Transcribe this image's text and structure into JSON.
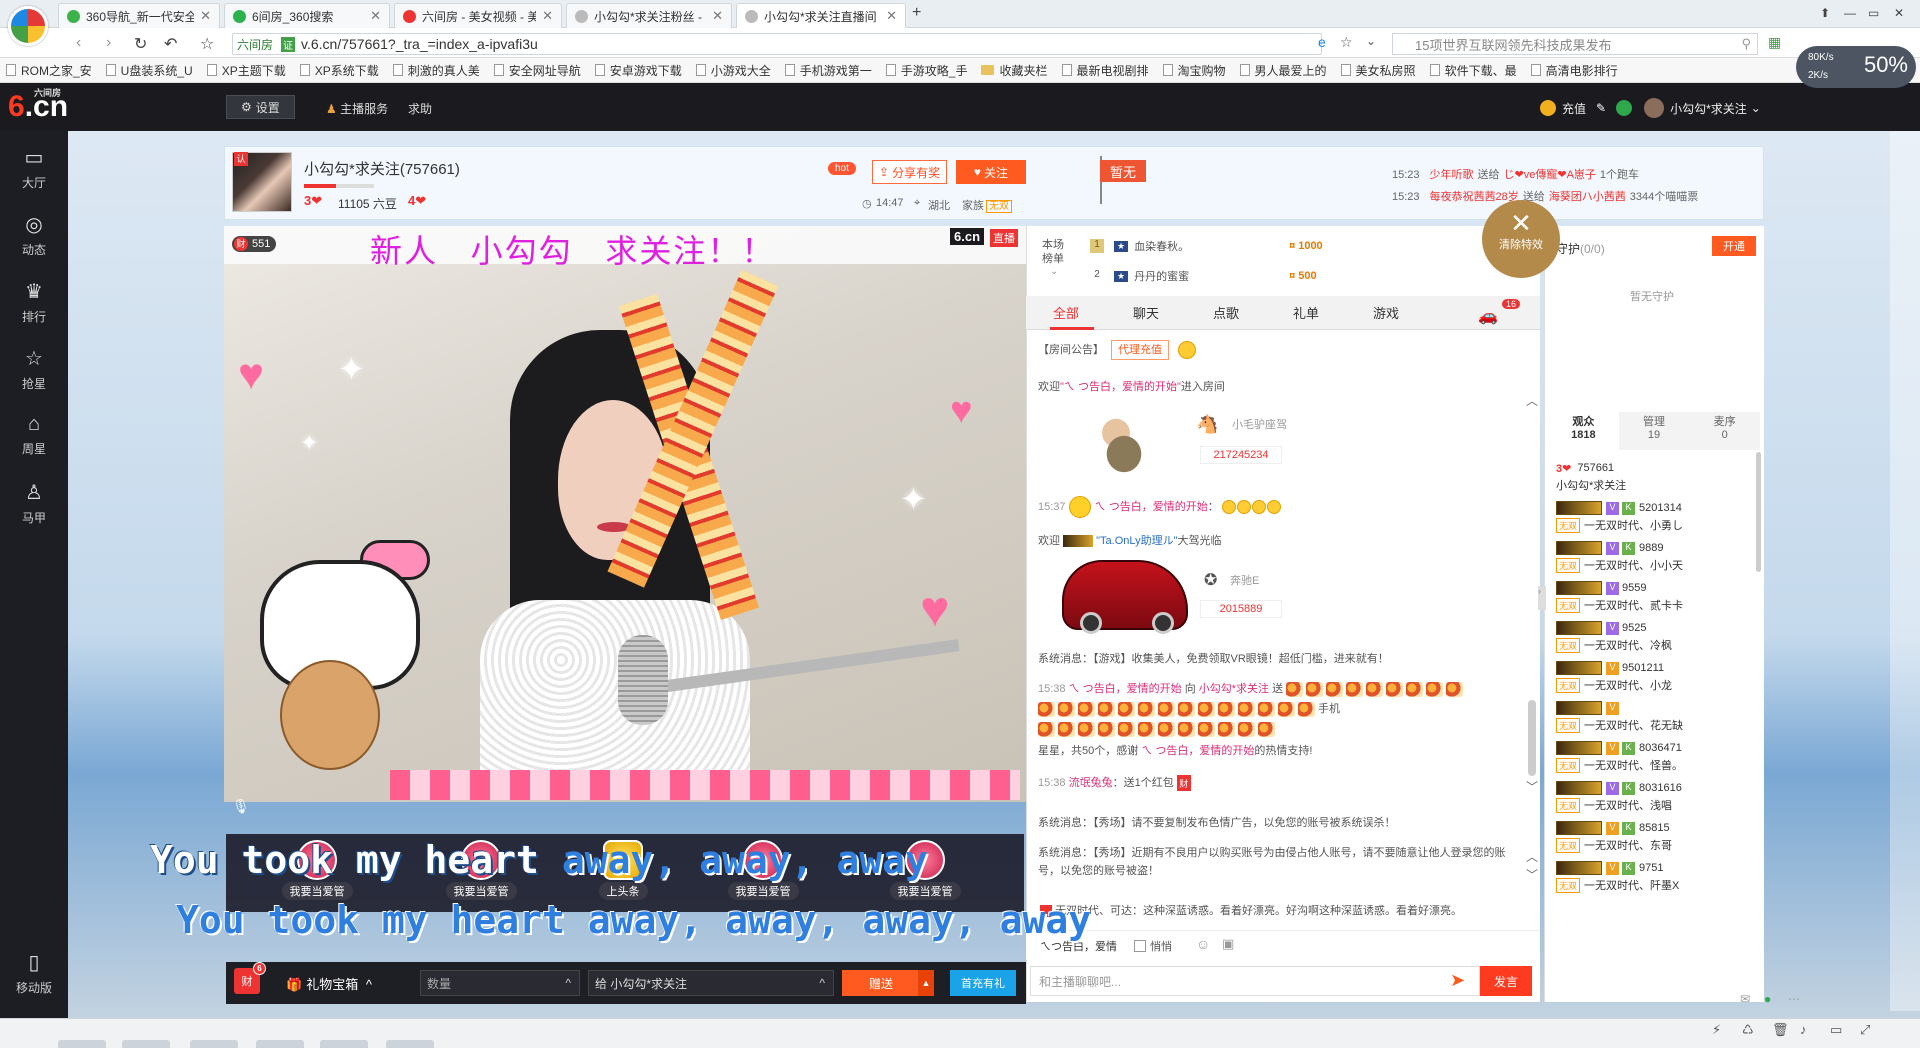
{
  "browser": {
    "tabs": [
      {
        "label": "360导航_新一代安全上网导航",
        "color": "#3cb34a"
      },
      {
        "label": "6间房_360搜索",
        "color": "#2bb24c"
      },
      {
        "label": "六间房 - 美女视频 - 美女直播",
        "color": "#e33"
      },
      {
        "label": "小勾勾*求关注粉丝 - 小勾勾",
        "color": "#bbb"
      },
      {
        "label": "小勾勾*求关注直播间 - 美女",
        "color": "#bbb"
      }
    ],
    "site_label": "六间房",
    "url": "v.6.cn/757661?_tra_=index_a-ipvafi3u",
    "search_placeholder": "15项世界互联网领先科技成果发布",
    "bookmarks": [
      {
        "label": "ROM之家_安",
        "type": "page"
      },
      {
        "label": "U盘装系统_U",
        "type": "page"
      },
      {
        "label": "XP主题下载",
        "type": "page"
      },
      {
        "label": "XP系统下载",
        "type": "page"
      },
      {
        "label": "刺激的真人美",
        "type": "page"
      },
      {
        "label": "安全网址导航",
        "type": "page"
      },
      {
        "label": "安卓游戏下载",
        "type": "page"
      },
      {
        "label": "小游戏大全",
        "type": "page"
      },
      {
        "label": "手机游戏第一",
        "type": "page"
      },
      {
        "label": "手游攻略_手",
        "type": "page"
      },
      {
        "label": "收藏夹栏",
        "type": "folder"
      },
      {
        "label": "最新电视剧排",
        "type": "page"
      },
      {
        "label": "淘宝购物",
        "type": "page"
      },
      {
        "label": "男人最爱上的",
        "type": "page"
      },
      {
        "label": "美女私房照",
        "type": "page"
      },
      {
        "label": "软件下载、最",
        "type": "page"
      },
      {
        "label": "高清电影排行",
        "type": "page"
      }
    ],
    "speed": {
      "down": "80K/s",
      "up": "2K/s",
      "percent": "50%"
    }
  },
  "site": {
    "logo_six": "6",
    "logo_cn": ".cn",
    "logo_sub": "六间房",
    "settings_label": "设置",
    "anchor_service": "主播服务",
    "help": "求助",
    "recharge": "充值",
    "user_name": "小勾勾*求关注"
  },
  "left_nav": [
    {
      "label": "大厅",
      "icon": "tv-icon",
      "glyph": "▭"
    },
    {
      "label": "动态",
      "icon": "compass-icon",
      "glyph": "◎"
    },
    {
      "label": "排行",
      "icon": "crown-icon",
      "glyph": "♛"
    },
    {
      "label": "抢星",
      "icon": "star-icon",
      "glyph": "☆"
    },
    {
      "label": "周星",
      "icon": "basket-icon",
      "glyph": "⌂"
    },
    {
      "label": "马甲",
      "icon": "vest-icon",
      "glyph": "♙"
    },
    {
      "label": "移动版",
      "icon": "phone-icon",
      "glyph": "▯"
    }
  ],
  "room": {
    "name": "小勾勾*求关注(757661)",
    "level_a": "3❤",
    "beans": "11105 六豆",
    "level_b": "4❤",
    "hot": "hot",
    "share": "分享有奖",
    "follow": "关注",
    "time": "14:47",
    "region": "湖北",
    "family_label": "家族",
    "family_tag": "无双",
    "flag": "暂无",
    "ticker": [
      {
        "time": "15:23",
        "text_a": "少年听歌",
        "mid": "送给",
        "text_b": "じ❤ve傳寵❤A崽子",
        "rest": "1个跑车"
      },
      {
        "time": "15:23",
        "text_a": "每夜恭祝茜茜28岁",
        "mid": "送给",
        "text_b": "海葵团ハ小茜茜",
        "rest": "3344个喵喵票"
      }
    ]
  },
  "video": {
    "headline": "新人   小勾勾   求关注！！",
    "fortune": "551",
    "fortune_icon": "财",
    "live_logo": "6.cn",
    "live_tag": "直播",
    "lyrics_1_a": "You took my heart ",
    "lyrics_1_b": "away, away, away",
    "lyrics_2": "You took my heart away, away, away, away",
    "guard_seats": [
      {
        "label": "我要当爱管",
        "top": false
      },
      {
        "label": "我要当爱管",
        "top": false
      },
      {
        "label": "上头条",
        "top": true
      },
      {
        "label": "我要当爱管",
        "top": false
      },
      {
        "label": "我要当爱管",
        "top": false
      }
    ]
  },
  "gift_bar": {
    "fortune_badge": "6",
    "fortune_icon": "财",
    "box_label": "礼物宝箱",
    "qty_placeholder": "数量",
    "to_value": "给 小勾勾*求关注",
    "send": "赠送",
    "first_gift": "首充有礼"
  },
  "rank": {
    "label": "本场榜单",
    "rows": [
      {
        "n": "1",
        "name": "血染春秋。",
        "coins": "1000"
      },
      {
        "n": "2",
        "name": "丹丹的蜜蜜",
        "coins": "500"
      }
    ]
  },
  "clear_fx": "清除特效",
  "chat": {
    "tabs": [
      "全部",
      "聊天",
      "点歌",
      "礼单",
      "游戏"
    ],
    "car_count": "16",
    "notice_label": "【房间公告】",
    "agent_btn": "代理充值",
    "welcome_1": {
      "pre": "欢迎",
      "name": "\"ㄟ つ告白，爱情的开始\"",
      "post": "进入房间"
    },
    "mount_1": {
      "name": "小毛驴座驾",
      "id": "217245234"
    },
    "msg_1537": {
      "time": "15:37",
      "name": "ㄟ つ告白，爱情的开始"
    },
    "welcome_2": {
      "pre": "欢迎",
      "name": "\"Ta.OnLy助理ル\"",
      "post": "大驾光临"
    },
    "mount_2": {
      "name": "奔驰E",
      "id": "2015889"
    },
    "sys_1": "系统消息：【游戏】收集美人，免费领取VR眼镜！超低门槛，进来就有！",
    "msg_1538": {
      "time": "15:38",
      "from": "ㄟ つ告白，爱情的开始",
      "to_pre": "向",
      "to": "小勾勾*求关注",
      "verb": "送",
      "gift": "手机",
      "line3_pre": "星星，共50个，感谢",
      "line3_name": "ㄟ つ告白，爱情的开始",
      "line3_post": "的热情支持!"
    },
    "msg_1538b": {
      "time": "15:38",
      "name": "流氓兔兔",
      "text": "：送1个红包"
    },
    "sys_2": "系统消息：【秀场】请不要复制发布色情广告，以免您的账号被系统误杀！",
    "sys_3": "系统消息：【秀场】近期有不良用户以购买账号为由侵占他人账号，请不要随意让他人登录您的账号，以免您的账号被盗！",
    "sys_4": "无双时代、可达：这种深蓝诱惑。看着好漂亮。好沟啊这种深蓝诱惑。看着好漂亮。",
    "target": "ㄟつ告白，爱情",
    "quiet": "悄悄",
    "input_placeholder": "和主播聊聊吧...",
    "send": "发言"
  },
  "guard_panel": {
    "title": "守护",
    "count": "(0/0)",
    "open": "开通",
    "empty": "暂无守护",
    "tabs": [
      {
        "label": "观众",
        "count": "1818"
      },
      {
        "label": "管理",
        "count": "19"
      },
      {
        "label": "麦序",
        "count": "0"
      }
    ],
    "host": {
      "level": "3❤",
      "id": "757661",
      "name": "小勾勾*求关注"
    },
    "audience": [
      {
        "id": "5201314",
        "name": "一无双时代、小勇し",
        "v": "purple",
        "k": true
      },
      {
        "id": "9889",
        "name": "一无双时代、小小天",
        "v": "purple",
        "k": true
      },
      {
        "id": "9559",
        "name": "一无双时代、贰卡卡",
        "v": "purple",
        "k": false
      },
      {
        "id": "9525",
        "name": "一无双时代、冷枫",
        "v": "purple",
        "k": false
      },
      {
        "id": "9501211",
        "name": "一无双时代、小龙",
        "v": "orange",
        "k": false
      },
      {
        "id": "",
        "name": "一无双时代、花无缺",
        "v": "orange",
        "k": false
      },
      {
        "id": "8036471",
        "name": "一无双时代、怪兽。",
        "v": "orange",
        "k": true
      },
      {
        "id": "8031616",
        "name": "一无双时代、浅唱",
        "v": "purple",
        "k": true
      },
      {
        "id": "85815",
        "name": "一无双时代、东哥",
        "v": "orange",
        "k": true
      },
      {
        "id": "9751",
        "name": "一无双时代、阡墨X",
        "v": "orange",
        "k": true
      }
    ],
    "fam_tag": "无双"
  }
}
